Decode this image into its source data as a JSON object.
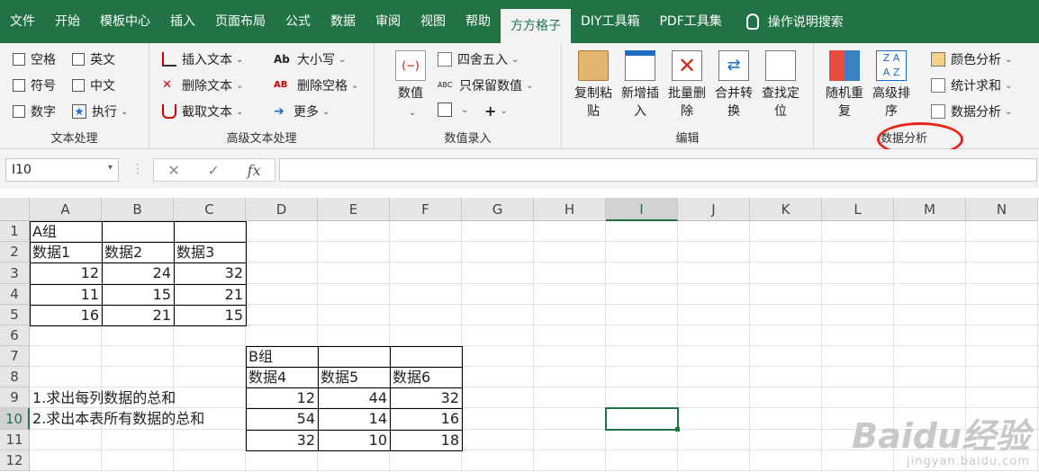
{
  "tabs": [
    "文件",
    "开始",
    "模板中心",
    "插入",
    "页面布局",
    "公式",
    "数据",
    "审阅",
    "视图",
    "帮助",
    "方方格子",
    "DIY工具箱",
    "PDF工具集"
  ],
  "tab_help": "操作说明搜索",
  "ribbon": {
    "text_proc": {
      "label": "文本处理",
      "items": [
        "空格",
        "英文",
        "符号",
        "中文",
        "数字",
        "执行"
      ]
    },
    "adv_text": {
      "label": "高级文本处理",
      "items": [
        "插入文本",
        "删除文本",
        "截取文本",
        "大小写",
        "删除空格",
        "更多"
      ]
    },
    "num_input": {
      "label": "数值录入",
      "big": "数值",
      "items": [
        "四舍五入",
        "只保留数值",
        "+"
      ]
    },
    "edit": {
      "label": "编辑",
      "buttons": [
        "复制粘\n贴",
        "新增插\n入",
        "批量删\n除",
        "合并转\n换",
        "查找定\n位"
      ]
    },
    "data_analysis": {
      "label": "数据分析",
      "buttons": [
        "随机重\n复",
        "高级排\n序"
      ],
      "items": [
        "颜色分析",
        "统计求和",
        "数据分析"
      ]
    }
  },
  "formula_bar": {
    "name_box": "I10",
    "cancel": "✕",
    "enter": "✓",
    "fx": "fx",
    "value": ""
  },
  "columns": [
    "A",
    "B",
    "C",
    "D",
    "E",
    "F",
    "G",
    "H",
    "I",
    "J",
    "K",
    "L",
    "M",
    "N"
  ],
  "rows": [
    "1",
    "2",
    "3",
    "4",
    "5",
    "6",
    "7",
    "8",
    "9",
    "10",
    "11",
    "12"
  ],
  "cells": {
    "A1": "A组",
    "A2": "数据1",
    "B2": "数据2",
    "C2": "数据3",
    "A3": "12",
    "B3": "24",
    "C3": "32",
    "A4": "11",
    "B4": "15",
    "C4": "21",
    "A5": "16",
    "B5": "21",
    "C5": "15",
    "D7": "B组",
    "D8": "数据4",
    "E8": "数据5",
    "F8": "数据6",
    "D9": "12",
    "E9": "44",
    "F9": "32",
    "D10": "54",
    "E10": "14",
    "F10": "16",
    "D11": "32",
    "E11": "10",
    "F11": "18",
    "A9": "1.求出每列数据的总和",
    "A10": "2.求出本表所有数据的总和"
  },
  "watermark": {
    "brand": "Baidu经验",
    "url": "jingyan.baidu.com"
  }
}
